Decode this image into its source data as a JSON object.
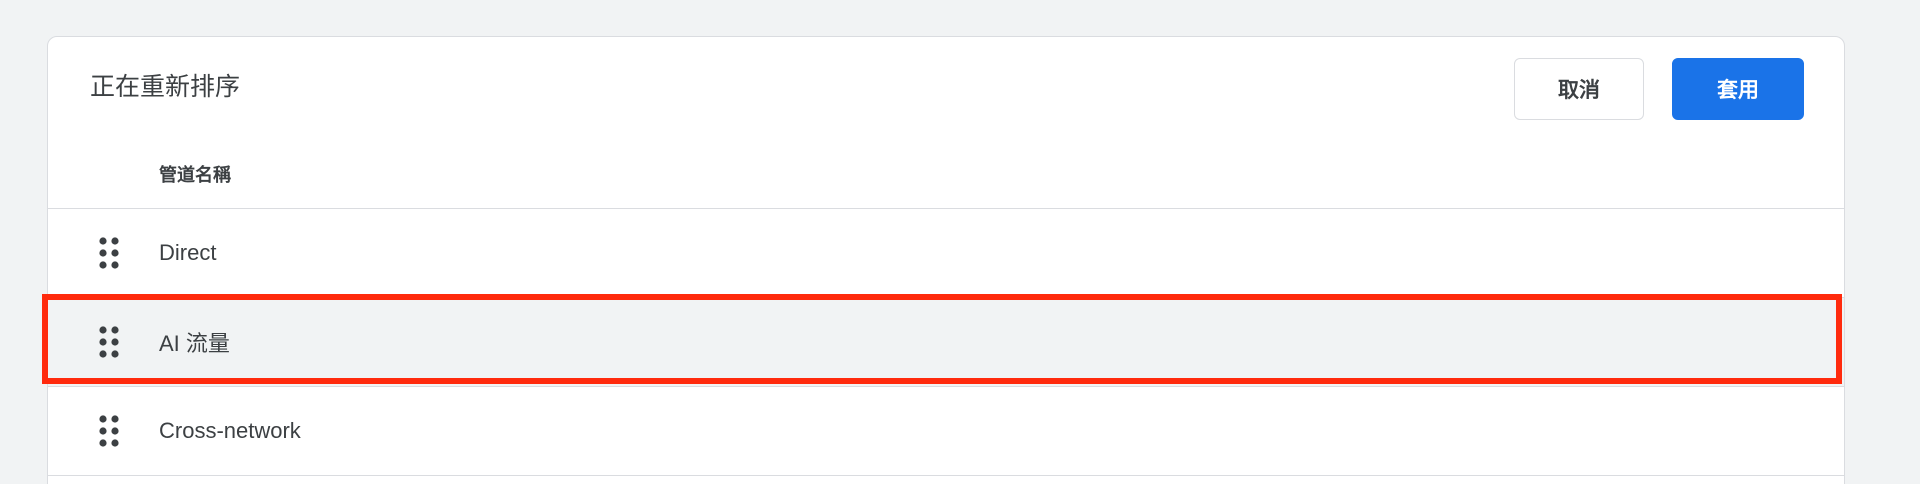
{
  "header": {
    "title": "正在重新排序",
    "cancel_label": "取消",
    "apply_label": "套用"
  },
  "table": {
    "column_header": "管道名稱",
    "rows": [
      {
        "label": "Direct",
        "highlighted": false
      },
      {
        "label": "AI 流量",
        "highlighted": true
      },
      {
        "label": "Cross-network",
        "highlighted": false
      }
    ]
  },
  "icons": {
    "drag_handle": "drag-indicator-icon"
  },
  "colors": {
    "primary": "#1a73e8",
    "highlight_border": "#ff2a0d",
    "background": "#f1f3f4",
    "divider": "#dadce0"
  }
}
